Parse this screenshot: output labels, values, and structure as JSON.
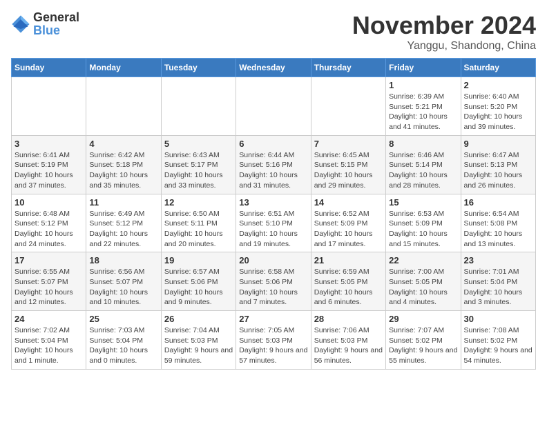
{
  "logo": {
    "general": "General",
    "blue": "Blue"
  },
  "title": "November 2024",
  "location": "Yanggu, Shandong, China",
  "weekdays": [
    "Sunday",
    "Monday",
    "Tuesday",
    "Wednesday",
    "Thursday",
    "Friday",
    "Saturday"
  ],
  "weeks": [
    [
      {
        "day": "",
        "info": ""
      },
      {
        "day": "",
        "info": ""
      },
      {
        "day": "",
        "info": ""
      },
      {
        "day": "",
        "info": ""
      },
      {
        "day": "",
        "info": ""
      },
      {
        "day": "1",
        "info": "Sunrise: 6:39 AM\nSunset: 5:21 PM\nDaylight: 10 hours and 41 minutes."
      },
      {
        "day": "2",
        "info": "Sunrise: 6:40 AM\nSunset: 5:20 PM\nDaylight: 10 hours and 39 minutes."
      }
    ],
    [
      {
        "day": "3",
        "info": "Sunrise: 6:41 AM\nSunset: 5:19 PM\nDaylight: 10 hours and 37 minutes."
      },
      {
        "day": "4",
        "info": "Sunrise: 6:42 AM\nSunset: 5:18 PM\nDaylight: 10 hours and 35 minutes."
      },
      {
        "day": "5",
        "info": "Sunrise: 6:43 AM\nSunset: 5:17 PM\nDaylight: 10 hours and 33 minutes."
      },
      {
        "day": "6",
        "info": "Sunrise: 6:44 AM\nSunset: 5:16 PM\nDaylight: 10 hours and 31 minutes."
      },
      {
        "day": "7",
        "info": "Sunrise: 6:45 AM\nSunset: 5:15 PM\nDaylight: 10 hours and 29 minutes."
      },
      {
        "day": "8",
        "info": "Sunrise: 6:46 AM\nSunset: 5:14 PM\nDaylight: 10 hours and 28 minutes."
      },
      {
        "day": "9",
        "info": "Sunrise: 6:47 AM\nSunset: 5:13 PM\nDaylight: 10 hours and 26 minutes."
      }
    ],
    [
      {
        "day": "10",
        "info": "Sunrise: 6:48 AM\nSunset: 5:12 PM\nDaylight: 10 hours and 24 minutes."
      },
      {
        "day": "11",
        "info": "Sunrise: 6:49 AM\nSunset: 5:12 PM\nDaylight: 10 hours and 22 minutes."
      },
      {
        "day": "12",
        "info": "Sunrise: 6:50 AM\nSunset: 5:11 PM\nDaylight: 10 hours and 20 minutes."
      },
      {
        "day": "13",
        "info": "Sunrise: 6:51 AM\nSunset: 5:10 PM\nDaylight: 10 hours and 19 minutes."
      },
      {
        "day": "14",
        "info": "Sunrise: 6:52 AM\nSunset: 5:09 PM\nDaylight: 10 hours and 17 minutes."
      },
      {
        "day": "15",
        "info": "Sunrise: 6:53 AM\nSunset: 5:09 PM\nDaylight: 10 hours and 15 minutes."
      },
      {
        "day": "16",
        "info": "Sunrise: 6:54 AM\nSunset: 5:08 PM\nDaylight: 10 hours and 13 minutes."
      }
    ],
    [
      {
        "day": "17",
        "info": "Sunrise: 6:55 AM\nSunset: 5:07 PM\nDaylight: 10 hours and 12 minutes."
      },
      {
        "day": "18",
        "info": "Sunrise: 6:56 AM\nSunset: 5:07 PM\nDaylight: 10 hours and 10 minutes."
      },
      {
        "day": "19",
        "info": "Sunrise: 6:57 AM\nSunset: 5:06 PM\nDaylight: 10 hours and 9 minutes."
      },
      {
        "day": "20",
        "info": "Sunrise: 6:58 AM\nSunset: 5:06 PM\nDaylight: 10 hours and 7 minutes."
      },
      {
        "day": "21",
        "info": "Sunrise: 6:59 AM\nSunset: 5:05 PM\nDaylight: 10 hours and 6 minutes."
      },
      {
        "day": "22",
        "info": "Sunrise: 7:00 AM\nSunset: 5:05 PM\nDaylight: 10 hours and 4 minutes."
      },
      {
        "day": "23",
        "info": "Sunrise: 7:01 AM\nSunset: 5:04 PM\nDaylight: 10 hours and 3 minutes."
      }
    ],
    [
      {
        "day": "24",
        "info": "Sunrise: 7:02 AM\nSunset: 5:04 PM\nDaylight: 10 hours and 1 minute."
      },
      {
        "day": "25",
        "info": "Sunrise: 7:03 AM\nSunset: 5:04 PM\nDaylight: 10 hours and 0 minutes."
      },
      {
        "day": "26",
        "info": "Sunrise: 7:04 AM\nSunset: 5:03 PM\nDaylight: 9 hours and 59 minutes."
      },
      {
        "day": "27",
        "info": "Sunrise: 7:05 AM\nSunset: 5:03 PM\nDaylight: 9 hours and 57 minutes."
      },
      {
        "day": "28",
        "info": "Sunrise: 7:06 AM\nSunset: 5:03 PM\nDaylight: 9 hours and 56 minutes."
      },
      {
        "day": "29",
        "info": "Sunrise: 7:07 AM\nSunset: 5:02 PM\nDaylight: 9 hours and 55 minutes."
      },
      {
        "day": "30",
        "info": "Sunrise: 7:08 AM\nSunset: 5:02 PM\nDaylight: 9 hours and 54 minutes."
      }
    ]
  ]
}
